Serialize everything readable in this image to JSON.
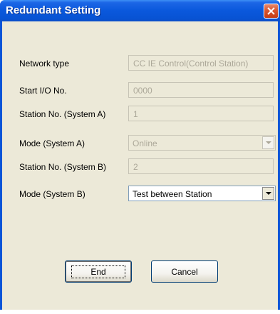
{
  "window": {
    "title": "Redundant Setting"
  },
  "icons": {
    "close": "close-icon",
    "dropdown": "chevron-down-icon"
  },
  "colors": {
    "titlebar": "#0a55d8",
    "close_button": "#d8552e",
    "dialog_background": "#ece9d8"
  },
  "form": {
    "network_type": {
      "label": "Network type",
      "value": "CC IE Control(Control Station)"
    },
    "start_io": {
      "label": "Start I/O No.",
      "value": "0000"
    },
    "station_a": {
      "label": "Station No. (System A)",
      "value": "1"
    },
    "mode_a": {
      "label": "Mode (System A)",
      "value": "Online"
    },
    "station_b": {
      "label": "Station No. (System B)",
      "value": "2"
    },
    "mode_b": {
      "label": "Mode (System B)",
      "value": "Test between Station"
    }
  },
  "buttons": {
    "end": "End",
    "cancel": "Cancel"
  }
}
